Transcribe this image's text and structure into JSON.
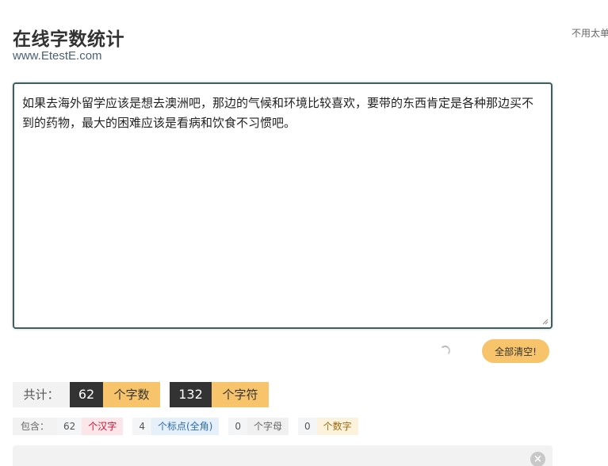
{
  "header": {
    "title": "在线字数统计",
    "subtitle": "www.EtestE.com",
    "side_note": "不用太单"
  },
  "editor": {
    "text": "如果去海外留学应该是想去澳洲吧，那边的气候和环境比较喜欢，要带的东西肯定是各种那边买不到的药物，最大的困难应该是看病和饮食不习惯吧。"
  },
  "actions": {
    "clear_label": "全部清空!"
  },
  "totals": {
    "label": "共计：",
    "word_count": "62",
    "word_unit": "个字数",
    "char_count": "132",
    "char_unit": "个字符"
  },
  "details": {
    "label": "包含：",
    "hanzi_count": "62",
    "hanzi_unit": "个汉字",
    "punct_count": "4",
    "punct_unit": "个标点(全角)",
    "letter_count": "0",
    "letter_unit": "个字母",
    "digit_count": "0",
    "digit_unit": "个数字"
  },
  "icons": {
    "close": "close-icon",
    "spinner": "loading-spinner-icon",
    "resize": "resize-grip-icon"
  },
  "colors": {
    "accent": "#f7c46b",
    "dark": "#333333",
    "editor_border": "#3f5f5f"
  }
}
